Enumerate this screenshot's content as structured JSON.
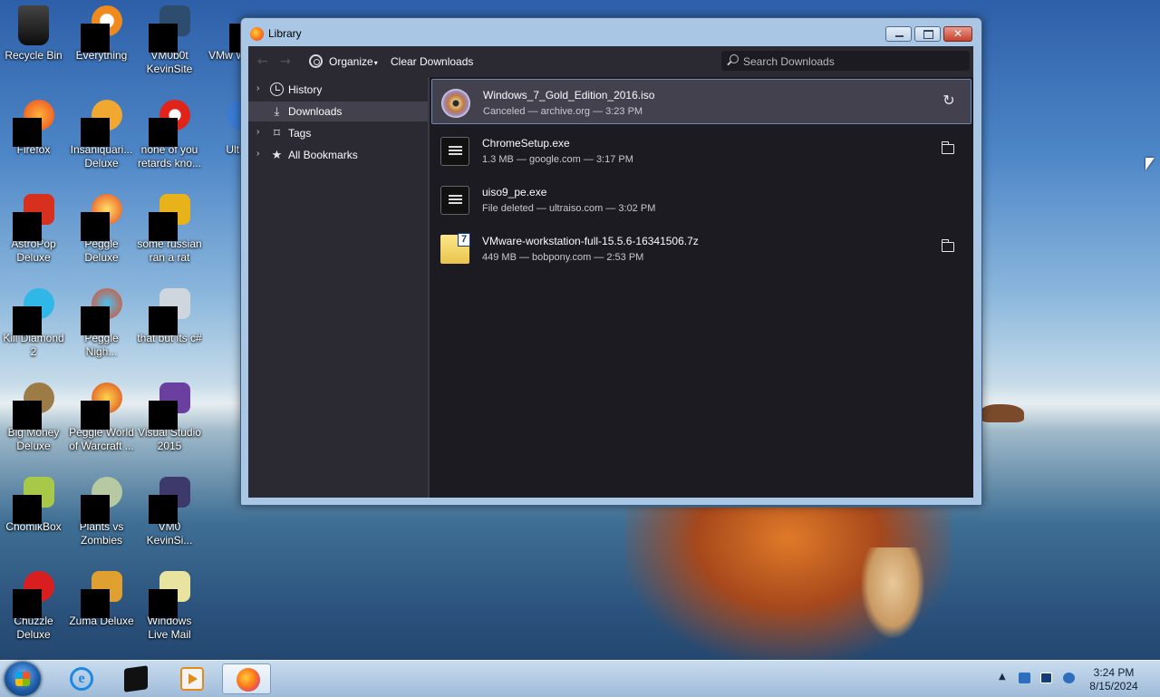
{
  "desktop": {
    "icons": [
      {
        "label": "Recycle Bin"
      },
      {
        "label": "Everything"
      },
      {
        "label": "VM0b0t KevinSite"
      },
      {
        "label": "VMw Works"
      },
      {
        "label": "Firefox"
      },
      {
        "label": "Insaniquari... Deluxe"
      },
      {
        "label": "none of you retards kno..."
      },
      {
        "label": "Ultra"
      },
      {
        "label": "AstroPop Deluxe"
      },
      {
        "label": "Peggle Deluxe"
      },
      {
        "label": "some russian ran a rat"
      },
      {
        "label": "Kill Diamond 2"
      },
      {
        "label": "Peggle Nigh..."
      },
      {
        "label": "that but its c#"
      },
      {
        "label": "Big Money Deluxe"
      },
      {
        "label": "Peggle World of Warcraft ..."
      },
      {
        "label": "Visual Studio 2015"
      },
      {
        "label": "ChomikBox"
      },
      {
        "label": "Plants vs Zombies"
      },
      {
        "label": "VM0 KevinSi..."
      },
      {
        "label": "Chuzzle Deluxe"
      },
      {
        "label": "Zuma Deluxe"
      },
      {
        "label": "Windows Live Mail"
      }
    ]
  },
  "window": {
    "title": "Library",
    "close_glyph": "✕"
  },
  "toolbar": {
    "back_glyph": "←",
    "forward_glyph": "→",
    "organize_label": "Organize",
    "organize_caret": "▾",
    "clear_label": "Clear Downloads",
    "search_placeholder": "Search Downloads"
  },
  "sidebar": {
    "items": [
      {
        "label": "History",
        "icon": "clock-icon",
        "twisty": "›"
      },
      {
        "label": "Downloads",
        "icon": "download-icon",
        "glyph": "⤓"
      },
      {
        "label": "Tags",
        "icon": "tag-icon",
        "twisty": "›",
        "glyph": "⌑"
      },
      {
        "label": "All Bookmarks",
        "icon": "star-icon",
        "twisty": "›",
        "glyph": "★"
      }
    ]
  },
  "downloads": [
    {
      "name": "Windows_7_Gold_Edition_2016.iso",
      "meta": "Canceled — archive.org — 3:23 PM",
      "action": "retry-icon",
      "action_glyph": "↻"
    },
    {
      "name": "ChromeSetup.exe",
      "meta": "1.3 MB — google.com — 3:17 PM",
      "action": "folder-icon"
    },
    {
      "name": "uiso9_pe.exe",
      "meta": "File deleted — ultraiso.com — 3:02 PM",
      "action": ""
    },
    {
      "name": "VMware-workstation-full-15.5.6-16341506.7z",
      "meta": "449 MB — bobpony.com — 2:53 PM",
      "action": "folder-icon"
    }
  ],
  "taskbar": {
    "ie_glyph": "e",
    "tray_up": "▲",
    "time": "3:24 PM",
    "date": "8/15/2024"
  },
  "colors": {
    "accent": "#6c8ab0",
    "window_frame": "#a9c7e4",
    "panel_dark": "#2b2a33",
    "content_dark": "#1c1b22"
  }
}
